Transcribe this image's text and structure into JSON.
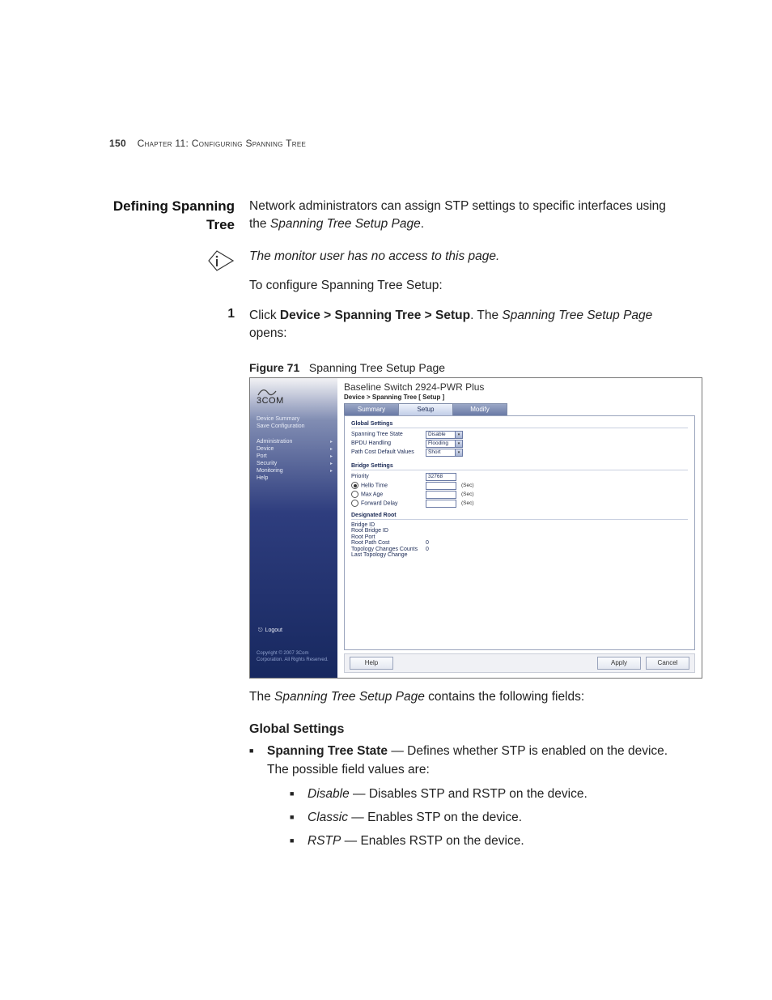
{
  "page": {
    "number": "150",
    "chapter_label": "Chapter 11: ",
    "chapter_title": "Configuring Spanning Tree"
  },
  "section": {
    "heading_line1": "Defining Spanning",
    "heading_line2": "Tree",
    "intro_a": "Network administrators can assign STP settings to specific interfaces using the ",
    "intro_em": "Spanning Tree Setup Page",
    "intro_b": ".",
    "note": "The monitor user has no access to this page.",
    "lead": "To configure Spanning Tree Setup:",
    "step_num": "1",
    "step_a": "Click ",
    "step_bold": "Device > Spanning Tree > Setup",
    "step_b": ". The ",
    "step_em": "Spanning Tree Setup Page",
    "step_c": " opens:"
  },
  "figure": {
    "label": "Figure 71",
    "caption": "Spanning Tree Setup Page"
  },
  "screenshot": {
    "brand": "3COM",
    "title": "Baseline Switch 2924-PWR Plus",
    "breadcrumb": "Device > Spanning Tree [ Setup ]",
    "tabs": [
      "Summary",
      "Setup",
      "Modify"
    ],
    "active_tab": 1,
    "nav_top": [
      "Device Summary",
      "Save Configuration"
    ],
    "nav_items": [
      "Administration",
      "Device",
      "Port",
      "Security",
      "Monitoring",
      "Help"
    ],
    "logout": "Logout",
    "copyright": "Copyright © 2007 3Com Corporation. All Rights Reserved.",
    "global": {
      "heading": "Global Settings",
      "stp_state_label": "Spanning Tree State",
      "stp_state_value": "Disable",
      "bpdu_label": "BPDU Handling",
      "bpdu_value": "Flooding",
      "pathcost_label": "Path Cost Default Values",
      "pathcost_value": "Short"
    },
    "bridge": {
      "heading": "Bridge Settings",
      "priority_label": "Priority",
      "priority_value": "32768",
      "hello_label": "Hello Time",
      "maxage_label": "Max Age",
      "fwd_label": "Forward Delay",
      "unit": "(Sec)"
    },
    "root": {
      "heading": "Designated Root",
      "rows": [
        {
          "k": "Bridge ID",
          "v": ""
        },
        {
          "k": "Root Bridge ID",
          "v": ""
        },
        {
          "k": "Root Port",
          "v": ""
        },
        {
          "k": "Root Path Cost",
          "v": "0"
        },
        {
          "k": "Topology Changes Counts",
          "v": "0"
        },
        {
          "k": "Last Topology Change",
          "v": ""
        }
      ]
    },
    "buttons": {
      "help": "Help",
      "apply": "Apply",
      "cancel": "Cancel"
    }
  },
  "after": {
    "p_a": "The ",
    "p_em": "Spanning Tree Setup Page",
    "p_b": " contains the following fields:",
    "h3": "Global Settings",
    "b1_bold": "Spanning Tree State",
    "b1_rest": " — Defines whether STP is enabled on the device. The possible field values are:",
    "sub": [
      {
        "em": "Disable",
        "rest": " — Disables STP and RSTP on the device."
      },
      {
        "em": "Classic",
        "rest": " — Enables STP on the device."
      },
      {
        "em": "RSTP",
        "rest": " — Enables RSTP on the device."
      }
    ]
  }
}
